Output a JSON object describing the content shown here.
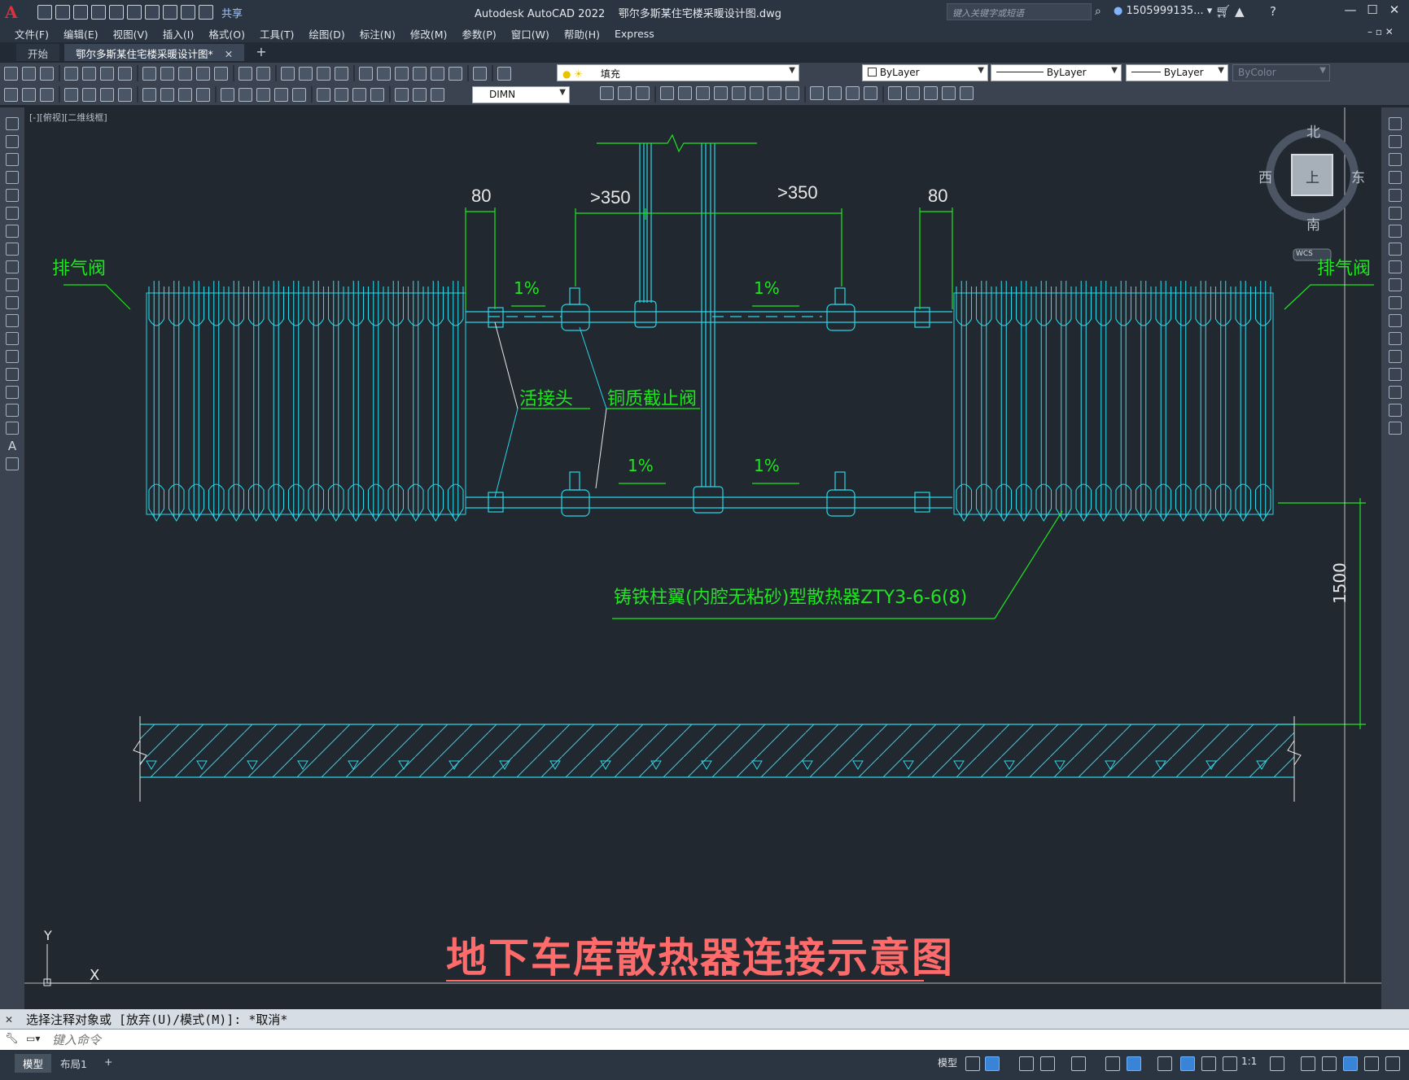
{
  "app": {
    "title": "Autodesk AutoCAD 2022",
    "file_name": "鄂尔多斯某住宅楼采暖设计图.dwg",
    "logo_letter": "A",
    "share_label": "共享",
    "search_placeholder": "键入关键字或短语",
    "user_name": "1505999135... ▾",
    "window_controls": [
      "—",
      "☐",
      "✕"
    ]
  },
  "menu": {
    "items": [
      "文件(F)",
      "编辑(E)",
      "视图(V)",
      "插入(I)",
      "格式(O)",
      "工具(T)",
      "绘图(D)",
      "标注(N)",
      "修改(M)",
      "参数(P)",
      "窗口(W)",
      "帮助(H)",
      "Express"
    ]
  },
  "tabs": {
    "start": "开始",
    "active": "鄂尔多斯某住宅楼采暖设计图*",
    "close": "✕",
    "add": "+"
  },
  "toolbar": {
    "layer_name": "填充",
    "color": "ByLayer",
    "linetype": "ByLayer",
    "lineweight": "ByLayer",
    "plotstyle": "ByColor",
    "dimstyle": "DIMN"
  },
  "viewport": {
    "label": "[-][俯视][二维线框]"
  },
  "viewcube": {
    "north": "北",
    "south": "南",
    "east": "东",
    "west": "西",
    "face": "上",
    "wcs": "WCS"
  },
  "drawing": {
    "dim_80_left": "80",
    "dim_350_left": ">350",
    "dim_350_right": ">350",
    "dim_80_right": "80",
    "vent_left": "排气阀",
    "vent_right": "排气阀",
    "slope": "1%",
    "union_label": "活接头",
    "valve_label": "铜质截止阀",
    "radiator_label": "铸铁柱翼(内腔无粘砂)型散热器ZTY3-6-6(8)",
    "height_dim": "1500",
    "title": "地下车库散热器连接示意图",
    "ucs_y": "Y",
    "ucs_x": "X"
  },
  "colors": {
    "cyan": "#29d5e6",
    "green": "#1fe61f",
    "white": "#e8e8e8",
    "title_red": "#ff6b6b"
  },
  "command": {
    "history": "选择注释对象或 [放弃(U)/模式(M)]: *取消*",
    "placeholder": "键入命令"
  },
  "status": {
    "model_tab": "模型",
    "layout_tab": "布局1",
    "add_tab": "+",
    "model_label": "模型",
    "scale": "1:1"
  }
}
